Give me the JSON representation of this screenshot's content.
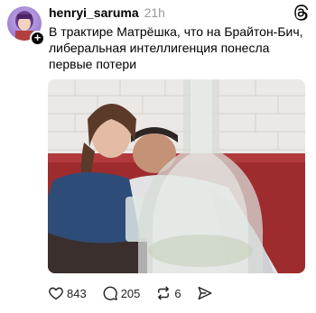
{
  "post": {
    "username": "henryi_saruma",
    "time": "21h",
    "text": "В трактире Матрёшка, что на Брайтон-Бич, либеральная интеллигенция понесла первые потери"
  },
  "actions": {
    "likes": "843",
    "comments": "205",
    "reposts": "6"
  },
  "icons": {
    "avatar": "avatar",
    "follow": "plus-icon",
    "app": "threads-logo-icon",
    "like": "heart-icon",
    "comment": "comment-icon",
    "repost": "repost-icon",
    "share": "send-icon"
  }
}
